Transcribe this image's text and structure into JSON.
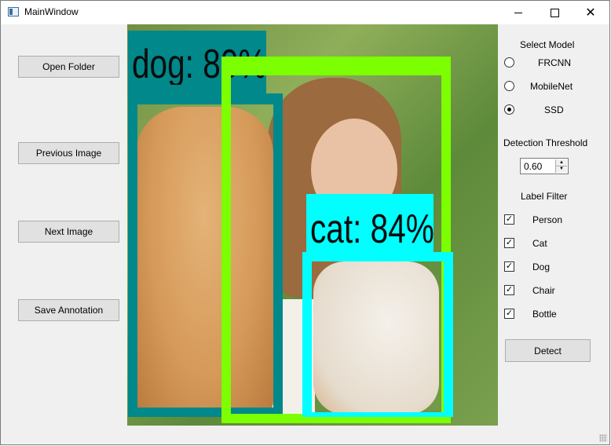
{
  "window": {
    "title": "MainWindow"
  },
  "titlebar": {
    "minimize": "—",
    "close": "✕"
  },
  "buttons": {
    "open_folder": "Open Folder",
    "previous_image": "Previous Image",
    "next_image": "Next Image",
    "save_annotation": "Save Annotation",
    "detect": "Detect"
  },
  "detections": [
    {
      "label": "dog: 80%",
      "color": "#00888a"
    },
    {
      "label": "cat: 84%",
      "color": "#00ffff"
    },
    {
      "label": "",
      "color": "#7cff00"
    }
  ],
  "model": {
    "heading": "Select Model",
    "options": [
      "FRCNN",
      "MobileNet",
      "SSD"
    ],
    "selected": "SSD"
  },
  "threshold": {
    "heading": "Detection Threshold",
    "value": "0.60"
  },
  "filter": {
    "heading": "Label Filter",
    "items": [
      {
        "label": "Person",
        "checked": true
      },
      {
        "label": "Cat",
        "checked": true
      },
      {
        "label": "Dog",
        "checked": true
      },
      {
        "label": "Chair",
        "checked": true
      },
      {
        "label": "Bottle",
        "checked": true
      }
    ]
  }
}
